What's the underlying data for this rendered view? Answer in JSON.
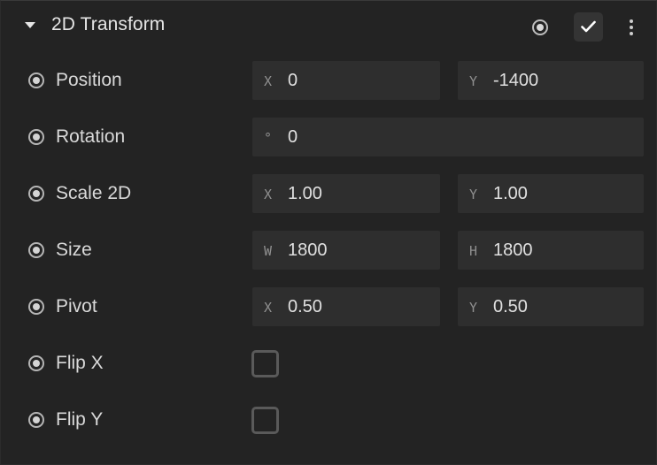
{
  "component": {
    "title": "2D Transform",
    "expanded": true,
    "enabled": true
  },
  "rows": {
    "position": {
      "label": "Position",
      "x_prefix": "X",
      "x": "0",
      "y_prefix": "Y",
      "y": "-1400"
    },
    "rotation": {
      "label": "Rotation",
      "prefix": "°",
      "value": "0"
    },
    "scale": {
      "label": "Scale 2D",
      "x_prefix": "X",
      "x": "1.00",
      "y_prefix": "Y",
      "y": "1.00"
    },
    "size": {
      "label": "Size",
      "w_prefix": "W",
      "w": "1800",
      "h_prefix": "H",
      "h": "1800"
    },
    "pivot": {
      "label": "Pivot",
      "x_prefix": "X",
      "x": "0.50",
      "y_prefix": "Y",
      "y": "0.50"
    },
    "flip_x": {
      "label": "Flip X",
      "checked": false
    },
    "flip_y": {
      "label": "Flip Y",
      "checked": false
    }
  },
  "icons": {
    "collapse": "caret-down-icon",
    "visibility": "radio-dot-icon",
    "enabled": "checkmark-icon",
    "more": "more-vertical-icon"
  },
  "colors": {
    "panel_bg": "#232323",
    "field_bg": "#2e2e2e",
    "text": "#dcdcdc",
    "prefix_text": "#8f8f8f"
  }
}
